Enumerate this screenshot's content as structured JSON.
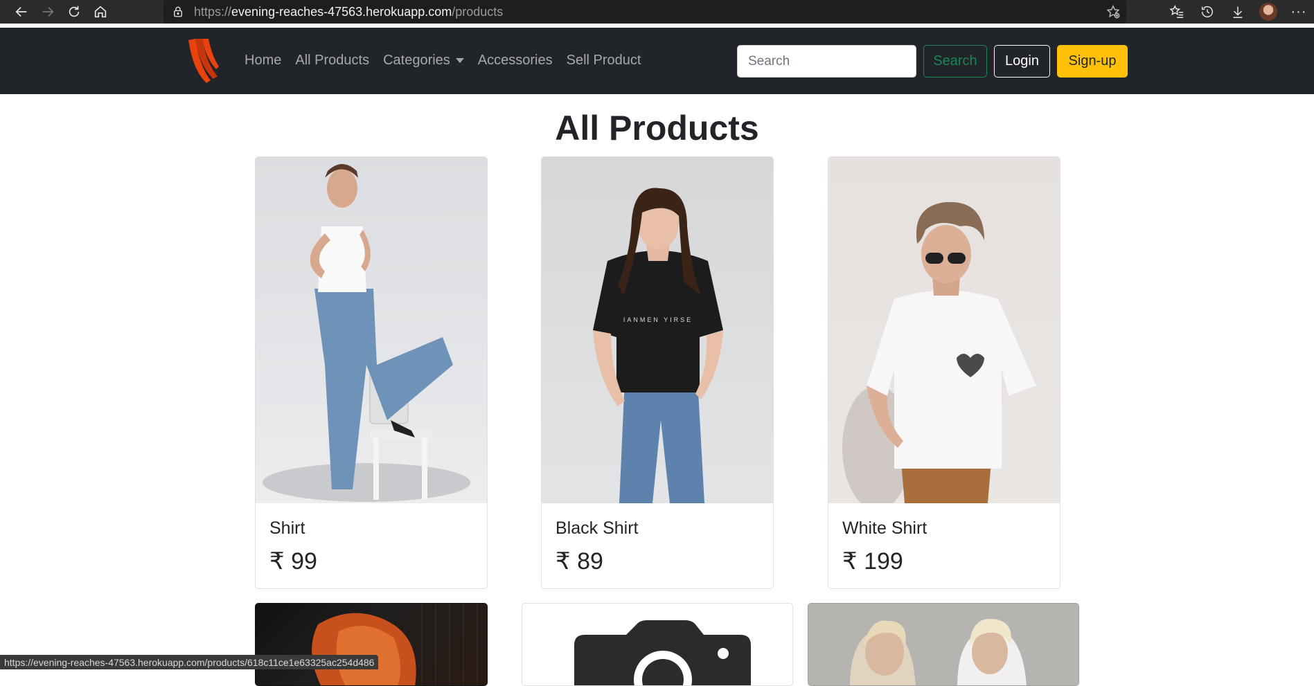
{
  "browser": {
    "url_scheme": "https://",
    "url_host": "evening-reaches-47563.herokuapp.com",
    "url_path": "/products",
    "status_url": "https://evening-reaches-47563.herokuapp.com/products/618c11ce1e63325ac254d486"
  },
  "navbar": {
    "links": {
      "home": "Home",
      "all_products": "All Products",
      "categories": "Categories",
      "accessories": "Accessories",
      "sell_product": "Sell Product"
    },
    "search_placeholder": "Search",
    "search_button": "Search",
    "login_button": "Login",
    "signup_button": "Sign-up",
    "colors": {
      "background": "#212529",
      "logo": "#e8420f",
      "search_button": "#198754",
      "signup_button": "#ffc107"
    }
  },
  "main": {
    "title": "All Products",
    "products": [
      {
        "name": "Shirt",
        "price": "₹ 99"
      },
      {
        "name": "Black Shirt",
        "price": "₹ 89"
      },
      {
        "name": "White Shirt",
        "price": "₹ 199"
      }
    ]
  }
}
